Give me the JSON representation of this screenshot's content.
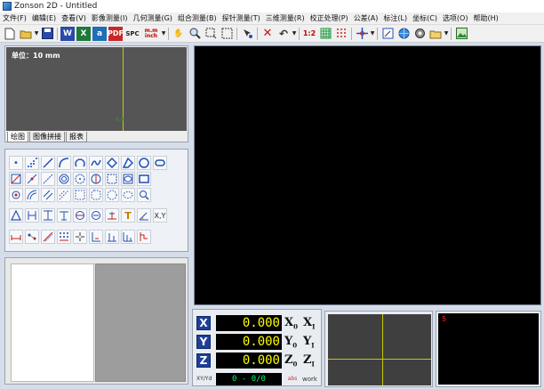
{
  "window": {
    "title": "Zonson 2D - Untitled"
  },
  "menu": [
    "文件(F)",
    "编辑(E)",
    "查看(V)",
    "影像测量(I)",
    "几何测量(G)",
    "组合测量(B)",
    "探针测量(T)",
    "三维测量(R)",
    "校正处理(P)",
    "公差(A)",
    "标注(L)",
    "坐标(C)",
    "选项(O)",
    "帮助(H)"
  ],
  "toolbar": {
    "word_label": "W",
    "excel_label": "X",
    "app_label": "a",
    "pdf_label": "PDF",
    "spc_label": "SPC",
    "mm_label": "m.m",
    "inch_label": "inch",
    "scale_label": "1:2",
    "icons": [
      "new-file-icon",
      "open-folder-icon",
      "save-icon",
      "word-icon",
      "excel-icon",
      "app-icon",
      "pdf-icon",
      "spc-icon",
      "mm-inch-icon",
      "hand-icon",
      "zoom-icon",
      "select-box-icon",
      "select-rect-icon",
      "cursor-icon",
      "delete-icon",
      "undo-icon",
      "scale-icon",
      "grid-icon",
      "dots-icon",
      "crosshair-icon",
      "edit-icon",
      "globe-icon",
      "gear-icon",
      "folder-icon",
      "picture-icon"
    ]
  },
  "preview": {
    "unit_text": "单位：10 mm",
    "marker": "0.0",
    "tabs": [
      "绘图",
      "图像拼接",
      "报表"
    ]
  },
  "palette": {
    "rows": [
      [
        "point",
        "dot-grid",
        "line",
        "arc",
        "circle-arc",
        "curve",
        "diamond",
        "angle-shape",
        "circle",
        "slot"
      ],
      [
        "auto-shape",
        "point-line",
        "diag-line",
        "ring",
        "target-circle",
        "arc-circle",
        "square",
        "oval-frame",
        "rect-frame"
      ],
      [
        "measure-point",
        "arc-measure",
        "multi-line",
        "dash-line",
        "dash-box",
        "round-box",
        "dash-circle",
        "ellipse-frame",
        "search"
      ],
      [
        "triangle",
        "h-dim",
        "i-dim",
        "t-dim",
        "circle-theta",
        "circle-minus",
        "coord-dim",
        "text",
        "angle-dim",
        "xy-dim"
      ],
      [
        "horiz-dim",
        "point-dim",
        "slant-dim",
        "point-set",
        "arrows",
        "corner-dim",
        "base-dim",
        "grid-dim",
        "step-dim"
      ]
    ],
    "labels": {
      "text": "T",
      "xy": "X,Y"
    }
  },
  "dro": {
    "axes": [
      {
        "axis": "X",
        "value": "0.000",
        "zero": "X",
        "zero_sub": "0",
        "set": "X",
        "set_sub": "I"
      },
      {
        "axis": "Y",
        "value": "0.000",
        "zero": "Y",
        "zero_sub": "0",
        "set": "Y",
        "set_sub": "I"
      },
      {
        "axis": "Z",
        "value": "0.000",
        "zero": "Z",
        "zero_sub": "0",
        "set": "Z",
        "set_sub": "I"
      }
    ],
    "xy_toggle": "XY/Yd",
    "counter": "0 - 0/0",
    "abs_label": "abs",
    "work_label": "work"
  },
  "small_view": {
    "number": "5"
  }
}
